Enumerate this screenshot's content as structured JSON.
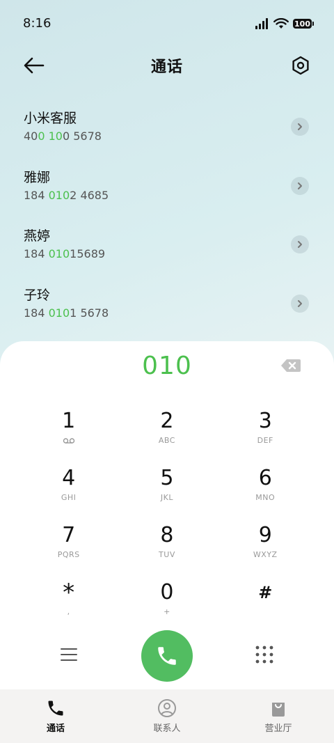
{
  "status_bar": {
    "time": "8:16",
    "battery": "100"
  },
  "header": {
    "title": "通话"
  },
  "contacts": [
    {
      "name": "小米客服",
      "number_parts": [
        "40",
        "0 10",
        "0 5678"
      ]
    },
    {
      "name": "雅娜",
      "number_parts": [
        "184 ",
        "010",
        "2 4685"
      ]
    },
    {
      "name": "燕婷",
      "number_parts": [
        "184 ",
        "010",
        "15689"
      ]
    },
    {
      "name": "子玲",
      "number_parts": [
        "184 ",
        "010",
        "1 5678"
      ]
    }
  ],
  "dialer": {
    "input": "010",
    "keys": [
      {
        "digit": "1",
        "sub": ""
      },
      {
        "digit": "2",
        "sub": "ABC"
      },
      {
        "digit": "3",
        "sub": "DEF"
      },
      {
        "digit": "4",
        "sub": "GHI"
      },
      {
        "digit": "5",
        "sub": "JKL"
      },
      {
        "digit": "6",
        "sub": "MNO"
      },
      {
        "digit": "7",
        "sub": "PQRS"
      },
      {
        "digit": "8",
        "sub": "TUV"
      },
      {
        "digit": "9",
        "sub": "WXYZ"
      },
      {
        "digit": "*",
        "sub": ","
      },
      {
        "digit": "0",
        "sub": "+"
      },
      {
        "digit": "#",
        "sub": ""
      }
    ]
  },
  "tabs": [
    {
      "label": "通话",
      "icon": "phone-icon",
      "active": true
    },
    {
      "label": "联系人",
      "icon": "person-icon",
      "active": false
    },
    {
      "label": "营业厅",
      "icon": "bag-icon",
      "active": false
    }
  ],
  "colors": {
    "accent_green": "#4cc04e",
    "call_button": "#52bd61"
  }
}
